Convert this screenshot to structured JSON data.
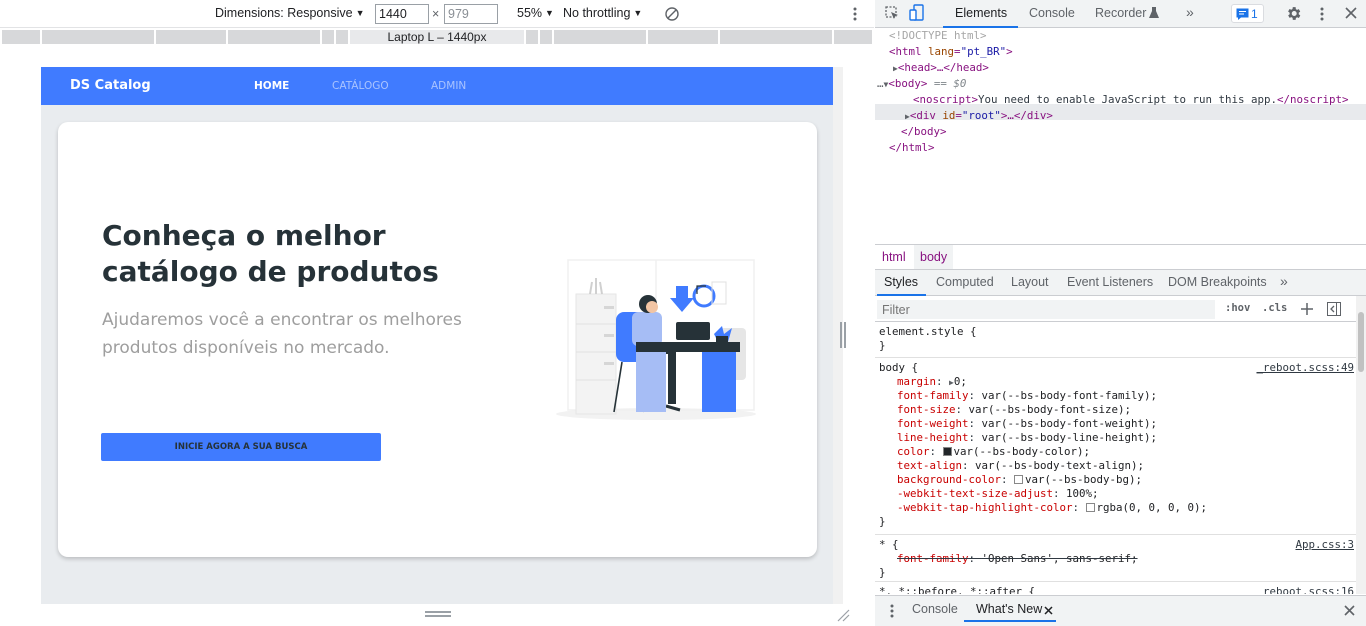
{
  "device_toolbar": {
    "dimensions_label": "Dimensions: Responsive",
    "width": "1440",
    "times": "×",
    "height": "979",
    "zoom": "55%",
    "throttling": "No throttling",
    "media_query_label": "Laptop L – 1440px"
  },
  "site": {
    "brand": "DS Catalog",
    "nav": [
      "HOME",
      "CATÁLOGO",
      "ADMIN"
    ],
    "title_line1": "Conheça o melhor",
    "title_line2": "catálogo de produtos",
    "subtitle": "Ajudaremos você a encontrar os melhores produtos disponíveis no mercado.",
    "cta": "INICIE AGORA A SUA BUSCA",
    "colors": {
      "primary": "#407bff",
      "page_bg": "#e9ecef",
      "title": "#263238",
      "subtitle": "#9e9e9e"
    }
  },
  "devtools": {
    "tabs": [
      "Elements",
      "Console",
      "Recorder",
      "»"
    ],
    "issues_count": "1",
    "dom": {
      "doctype": "<!DOCTYPE html>",
      "html_open": "<html",
      "html_lang_attr": "lang",
      "html_lang_val": "\"pt_BR\"",
      "head": "<head>…</head>",
      "body_open": "<body>",
      "body_marker": "== $0",
      "noscript_open": "<noscript>",
      "noscript_text": "You need to enable JavaScript to run this app.",
      "noscript_close": "</noscript>",
      "div_open": "<div",
      "div_attr": "id",
      "div_val": "\"root\"",
      "div_rest": ">…</div>",
      "body_close": "</body>",
      "html_close": "</html>",
      "ellipsis": "…"
    },
    "breadcrumbs": [
      "html",
      "body"
    ],
    "sub_tabs": [
      "Styles",
      "Computed",
      "Layout",
      "Event Listeners",
      "DOM Breakpoints",
      "»"
    ],
    "filter_placeholder": "Filter",
    "hov": ":hov",
    "cls": ".cls",
    "styles": {
      "element_style": "element.style {",
      "close_brace": "}",
      "body_selector": "body {",
      "body_source": "_reboot.scss:49",
      "body_props": [
        {
          "name": "margin",
          "value": "0;",
          "expandable": true
        },
        {
          "name": "font-family",
          "value": "var(--bs-body-font-family);"
        },
        {
          "name": "font-size",
          "value": "var(--bs-body-font-size);"
        },
        {
          "name": "font-weight",
          "value": "var(--bs-body-font-weight);"
        },
        {
          "name": "line-height",
          "value": "var(--bs-body-line-height);"
        },
        {
          "name": "color",
          "value": "var(--bs-body-color);",
          "swatch": "#212529"
        },
        {
          "name": "text-align",
          "value": "var(--bs-body-text-align);"
        },
        {
          "name": "background-color",
          "value": "var(--bs-body-bg);",
          "swatch": "#ffffff"
        },
        {
          "name": "-webkit-text-size-adjust",
          "value": "100%;"
        },
        {
          "name": "-webkit-tap-highlight-color",
          "value": "rgba(0, 0, 0, 0);",
          "swatch": "#ffffff"
        }
      ],
      "star_selector": "* {",
      "star_source": "App.css:3",
      "star_prop": "font-family",
      "star_value": "'Open Sans', sans-serif;",
      "before_selector": "*, *::before, *::after {",
      "before_source": "_reboot.scss:16"
    },
    "drawer_tabs": [
      "Console",
      "What's New"
    ]
  }
}
